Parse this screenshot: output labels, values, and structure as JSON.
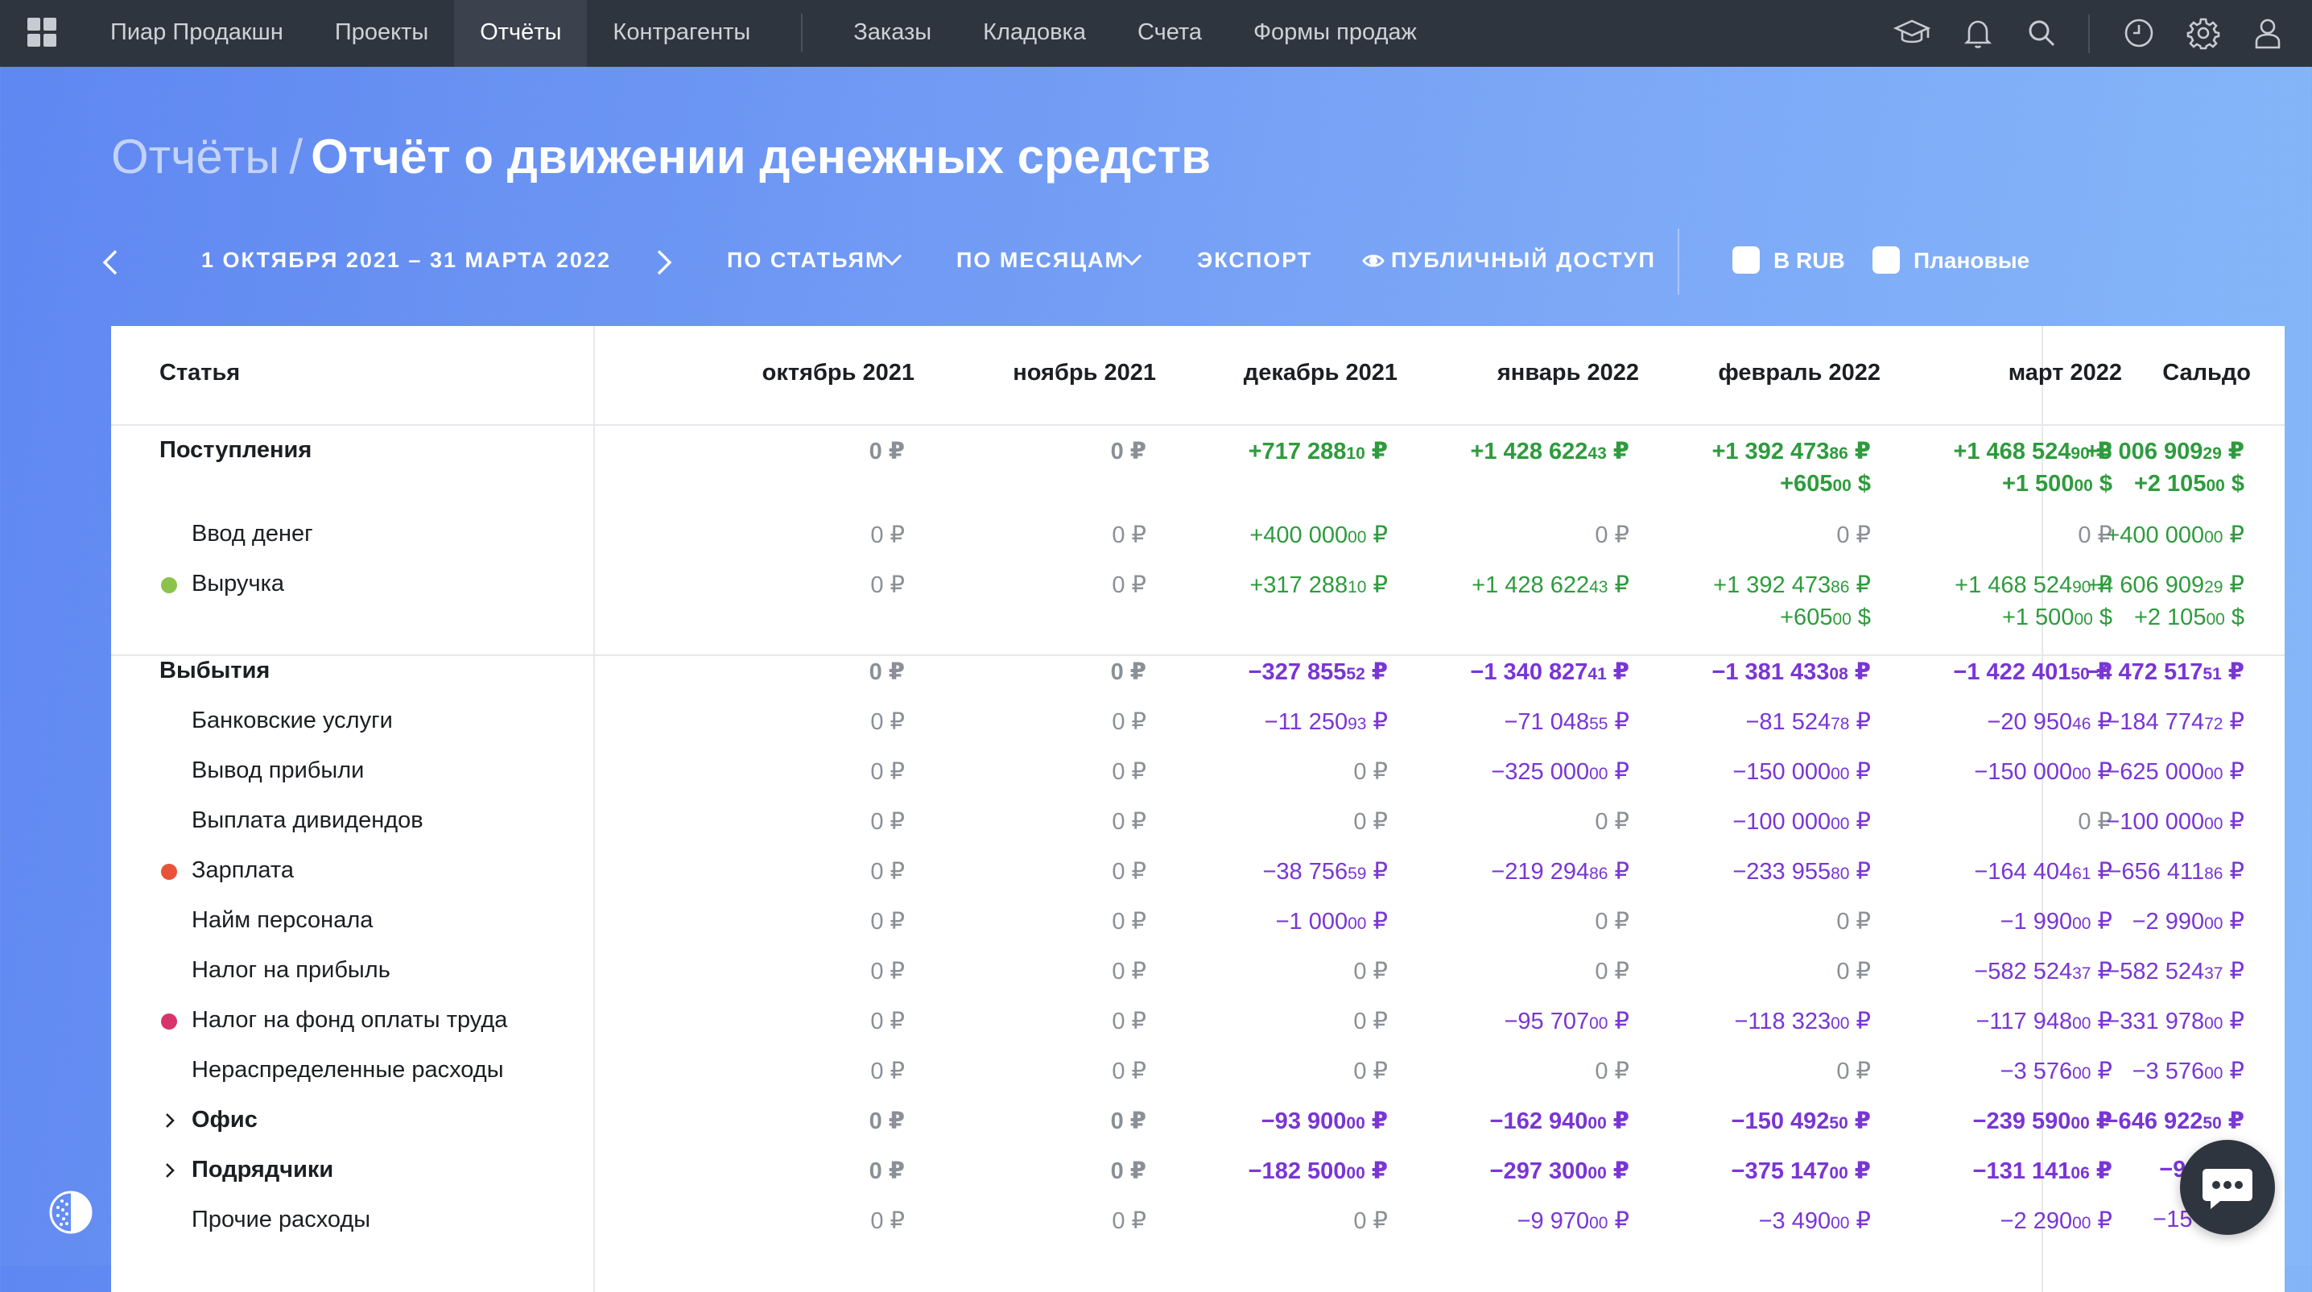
{
  "topbar": {
    "nav": [
      "Пиар Продакшн",
      "Проекты",
      "Отчёты",
      "Контрагенты"
    ],
    "nav_secondary": [
      "Заказы",
      "Кладовка",
      "Счета",
      "Формы продаж"
    ],
    "active": "Отчёты",
    "icons": [
      "learning-hat-icon",
      "bell-icon",
      "search-icon",
      "clock-icon",
      "gear-icon",
      "user-icon"
    ]
  },
  "title": {
    "crumb": "Отчёты",
    "separator": "/",
    "current": "Отчёт о движении денежных средств"
  },
  "toolbar": {
    "period": "1 ОКТЯБРЯ 2021 – 31 МАРТА 2022",
    "group_by": "ПО СТАТЬЯМ",
    "interval": "ПО МЕСЯЦАМ",
    "export": "ЭКСПОРТ",
    "public_access": "ПУБЛИЧНЫЙ ДОСТУП",
    "in_rub": "В RUB",
    "planned": "Плановые"
  },
  "table": {
    "headers": [
      "Статья",
      "октябрь 2021",
      "ноябрь 2021",
      "декабрь 2021",
      "январь 2022",
      "февраль 2022",
      "март 2022",
      "Сальдо"
    ],
    "rows": [
      {
        "label": "Поступления",
        "type": "section",
        "tone": "pos",
        "values": [
          [
            "0 ₽"
          ],
          [
            "0 ₽"
          ],
          [
            "+717 288,10 ₽"
          ],
          [
            "+1 428 622,43 ₽"
          ],
          [
            "+1 392 473,86 ₽",
            "+605,00 $"
          ],
          [
            "+1 468 524,90 ₽",
            "+1 500,00 $"
          ],
          [
            "+5 006 909,29 ₽",
            "+2 105,00 $"
          ]
        ]
      },
      {
        "label": "Ввод денег",
        "type": "item",
        "tone": "pos",
        "values": [
          [
            "0 ₽"
          ],
          [
            "0 ₽"
          ],
          [
            "+400 000,00 ₽"
          ],
          [
            "0 ₽"
          ],
          [
            "0 ₽"
          ],
          [
            "0 ₽"
          ],
          [
            "+400 000,00 ₽"
          ]
        ]
      },
      {
        "label": "Выручка",
        "type": "item",
        "tone": "pos",
        "dot": "#8bc34a",
        "values": [
          [
            "0 ₽"
          ],
          [
            "0 ₽"
          ],
          [
            "+317 288,10 ₽"
          ],
          [
            "+1 428 622,43 ₽"
          ],
          [
            "+1 392 473,86 ₽",
            "+605,00 $"
          ],
          [
            "+1 468 524,90 ₽",
            "+1 500,00 $"
          ],
          [
            "+4 606 909,29 ₽",
            "+2 105,00 $"
          ]
        ]
      },
      {
        "label": "Выбытия",
        "type": "section",
        "tone": "neg",
        "values": [
          [
            "0 ₽"
          ],
          [
            "0 ₽"
          ],
          [
            "−327 855,52 ₽"
          ],
          [
            "−1 340 827,41 ₽"
          ],
          [
            "−1 381 433,08 ₽"
          ],
          [
            "−1 422 401,50 ₽"
          ],
          [
            "−4 472 517,51 ₽"
          ]
        ]
      },
      {
        "label": "Банковские услуги",
        "type": "item",
        "tone": "neg",
        "values": [
          [
            "0 ₽"
          ],
          [
            "0 ₽"
          ],
          [
            "−11 250,93 ₽"
          ],
          [
            "−71 048,55 ₽"
          ],
          [
            "−81 524,78 ₽"
          ],
          [
            "−20 950,46 ₽"
          ],
          [
            "−184 774,72 ₽"
          ]
        ]
      },
      {
        "label": "Вывод прибыли",
        "type": "item",
        "tone": "neg",
        "values": [
          [
            "0 ₽"
          ],
          [
            "0 ₽"
          ],
          [
            "0 ₽"
          ],
          [
            "−325 000,00 ₽"
          ],
          [
            "−150 000,00 ₽"
          ],
          [
            "−150 000,00 ₽"
          ],
          [
            "−625 000,00 ₽"
          ]
        ]
      },
      {
        "label": "Выплата дивидендов",
        "type": "item",
        "tone": "neg",
        "values": [
          [
            "0 ₽"
          ],
          [
            "0 ₽"
          ],
          [
            "0 ₽"
          ],
          [
            "0 ₽"
          ],
          [
            "−100 000,00 ₽"
          ],
          [
            "0 ₽"
          ],
          [
            "−100 000,00 ₽"
          ]
        ]
      },
      {
        "label": "Зарплата",
        "type": "item",
        "tone": "neg",
        "dot": "#e8533a",
        "values": [
          [
            "0 ₽"
          ],
          [
            "0 ₽"
          ],
          [
            "−38 756,59 ₽"
          ],
          [
            "−219 294,86 ₽"
          ],
          [
            "−233 955,80 ₽"
          ],
          [
            "−164 404,61 ₽"
          ],
          [
            "−656 411,86 ₽"
          ]
        ]
      },
      {
        "label": "Найм персонала",
        "type": "item",
        "tone": "neg",
        "values": [
          [
            "0 ₽"
          ],
          [
            "0 ₽"
          ],
          [
            "−1 000,00 ₽"
          ],
          [
            "0 ₽"
          ],
          [
            "0 ₽"
          ],
          [
            "−1 990,00 ₽"
          ],
          [
            "−2 990,00 ₽"
          ]
        ]
      },
      {
        "label": "Налог на прибыль",
        "type": "item",
        "tone": "neg",
        "values": [
          [
            "0 ₽"
          ],
          [
            "0 ₽"
          ],
          [
            "0 ₽"
          ],
          [
            "0 ₽"
          ],
          [
            "0 ₽"
          ],
          [
            "−582 524,37 ₽"
          ],
          [
            "−582 524,37 ₽"
          ]
        ]
      },
      {
        "label": "Налог на фонд оплаты труда",
        "type": "item",
        "tone": "neg",
        "dot": "#d8336b",
        "values": [
          [
            "0 ₽"
          ],
          [
            "0 ₽"
          ],
          [
            "0 ₽"
          ],
          [
            "−95 707,00 ₽"
          ],
          [
            "−118 323,00 ₽"
          ],
          [
            "−117 948,00 ₽"
          ],
          [
            "−331 978,00 ₽"
          ]
        ]
      },
      {
        "label": "Нераспределенные расходы",
        "type": "item",
        "tone": "neg",
        "values": [
          [
            "0 ₽"
          ],
          [
            "0 ₽"
          ],
          [
            "0 ₽"
          ],
          [
            "0 ₽"
          ],
          [
            "0 ₽"
          ],
          [
            "−3 576,00 ₽"
          ],
          [
            "−3 576,00 ₽"
          ]
        ]
      },
      {
        "label": "Офис",
        "type": "group",
        "tone": "neg",
        "values": [
          [
            "0 ₽"
          ],
          [
            "0 ₽"
          ],
          [
            "−93 900,00 ₽"
          ],
          [
            "−162 940,00 ₽"
          ],
          [
            "−150 492,50 ₽"
          ],
          [
            "−239 590,00 ₽"
          ],
          [
            "−646 922,50 ₽"
          ]
        ]
      },
      {
        "label": "Подрядчики",
        "type": "group",
        "tone": "neg",
        "values": [
          [
            "0 ₽"
          ],
          [
            "0 ₽"
          ],
          [
            "−182 500,00 ₽"
          ],
          [
            "−297 300,00 ₽"
          ],
          [
            "−375 147,00 ₽"
          ],
          [
            "−131 141,06 ₽"
          ],
          [
            "−986 08"
          ]
        ]
      },
      {
        "label": "Прочие расходы",
        "type": "item",
        "tone": "neg",
        "values": [
          [
            "0 ₽"
          ],
          [
            "0 ₽"
          ],
          [
            "0 ₽"
          ],
          [
            "−9 970,00 ₽"
          ],
          [
            "−3 490,00 ₽"
          ],
          [
            "−2 290,00 ₽"
          ],
          [
            "−15 750,"
          ]
        ]
      }
    ]
  }
}
